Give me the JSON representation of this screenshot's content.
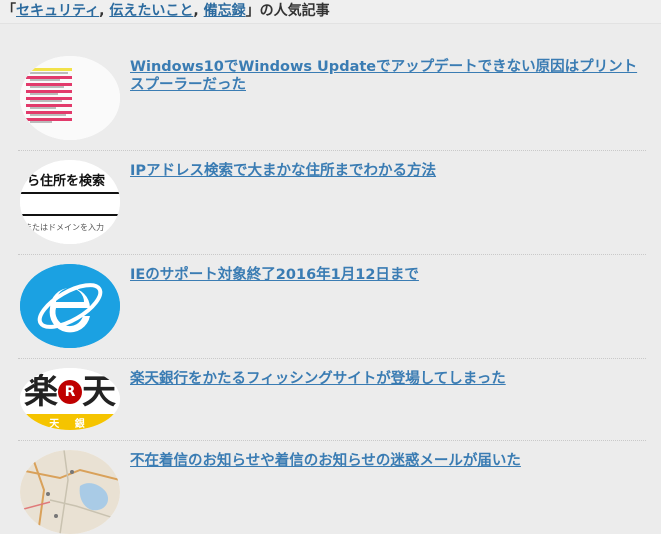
{
  "header": {
    "bracket_open": "「",
    "tags": [
      "セキュリティ",
      "伝えたいこと",
      "備忘録"
    ],
    "separator": ",",
    "bracket_close": "」",
    "suffix": "の人気記事"
  },
  "articles": [
    {
      "title": "Windows10でWindows Updateでアップデートできない原因はプリントスプーラーだった",
      "thumb_icon": "windows-update-error-thumbnail"
    },
    {
      "title": "IPアドレス検索で大まかな住所までわかる方法",
      "thumb_icon": "ip-address-lookup-thumbnail",
      "thumb_text_top": "から住所を検索",
      "thumb_text_bottom": "またはドメインを入力"
    },
    {
      "title": "IEのサポート対象終了2016年1月12日まで",
      "thumb_icon": "internet-explorer-logo"
    },
    {
      "title": "楽天銀行をかたるフィッシングサイトが登場してしまった",
      "thumb_icon": "rakuten-bank-logo",
      "thumb_text_left": "楽",
      "thumb_text_badge": "R",
      "thumb_text_right": "天",
      "thumb_text_bottom": "天 銀"
    },
    {
      "title": "不在着信のお知らせや着信のお知らせの迷惑メールが届いた",
      "thumb_icon": "map-thumbnail"
    }
  ],
  "colors": {
    "background": "#ececec",
    "link": "#3a7cb3",
    "header_link": "#2c6b9f",
    "ie_blue": "#1ba1e2",
    "rakuten_red": "#bf0000",
    "rakuten_yellow": "#f5c400"
  }
}
